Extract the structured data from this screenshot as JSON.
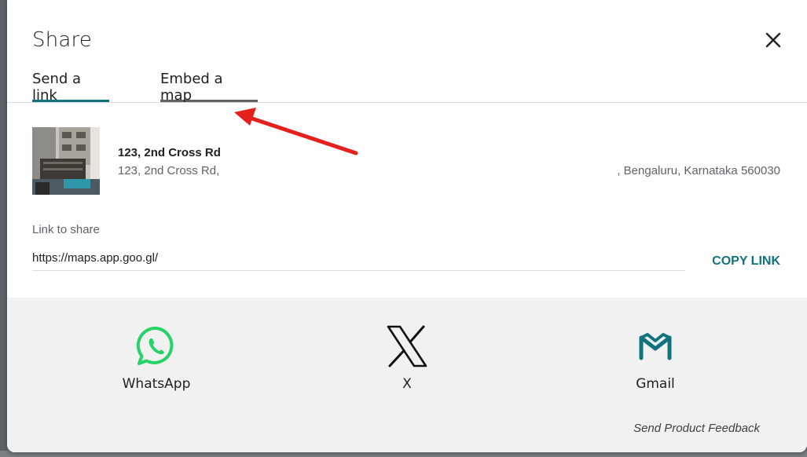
{
  "dialog": {
    "title": "Share",
    "close_icon": "close-icon",
    "tabs": [
      {
        "label": "Send a link",
        "active": true
      },
      {
        "label": "Embed a map",
        "active": false
      }
    ]
  },
  "place": {
    "name": "123, 2nd Cross Rd",
    "address_start": "123, 2nd Cross Rd, ",
    "address_end": ", Bengaluru, Karnataka 560030"
  },
  "link": {
    "label": "Link to share",
    "value": "https://maps.app.goo.gl/",
    "copy_label": "COPY LINK"
  },
  "share_options": [
    {
      "label": "WhatsApp",
      "icon": "whatsapp-icon"
    },
    {
      "label": "X",
      "icon": "x-icon"
    },
    {
      "label": "Gmail",
      "icon": "gmail-icon"
    }
  ],
  "feedback_label": "Send Product Feedback",
  "colors": {
    "accent": "#11737e",
    "whatsapp": "#25d366",
    "annotation_arrow": "#e3201b"
  }
}
